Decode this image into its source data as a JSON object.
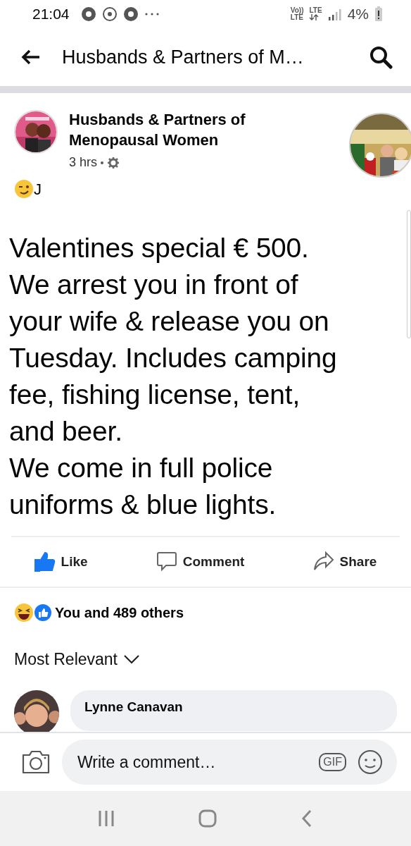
{
  "status_bar": {
    "time": "21:04",
    "network_labels": [
      "Vo))",
      "LTE",
      "LTE"
    ],
    "battery": "4%"
  },
  "header": {
    "title": "Husbands & Partners of M…"
  },
  "post": {
    "author": "Husbands & Partners of Menopausal Women",
    "time": "3 hrs",
    "caption": "J",
    "image_lines": [
      "Valentines special € 500.",
      "We arrest you in front of",
      "your wife & release you on",
      "Tuesday. Includes camping",
      "fee, fishing license, tent,",
      "and beer.",
      "We come in full police",
      "uniforms & blue lights."
    ],
    "actions": [
      {
        "kind": "like",
        "label": "Like",
        "selected": true
      },
      {
        "kind": "comment",
        "label": "Comment",
        "selected": false
      },
      {
        "kind": "share",
        "label": "Share",
        "selected": false
      }
    ],
    "reactions": "You and 489 others"
  },
  "comments": {
    "sort": "Most Relevant",
    "items": [
      {
        "author": "Lynne Canavan"
      }
    ]
  },
  "composer": {
    "placeholder": "Write a comment…",
    "gif": "GIF"
  }
}
